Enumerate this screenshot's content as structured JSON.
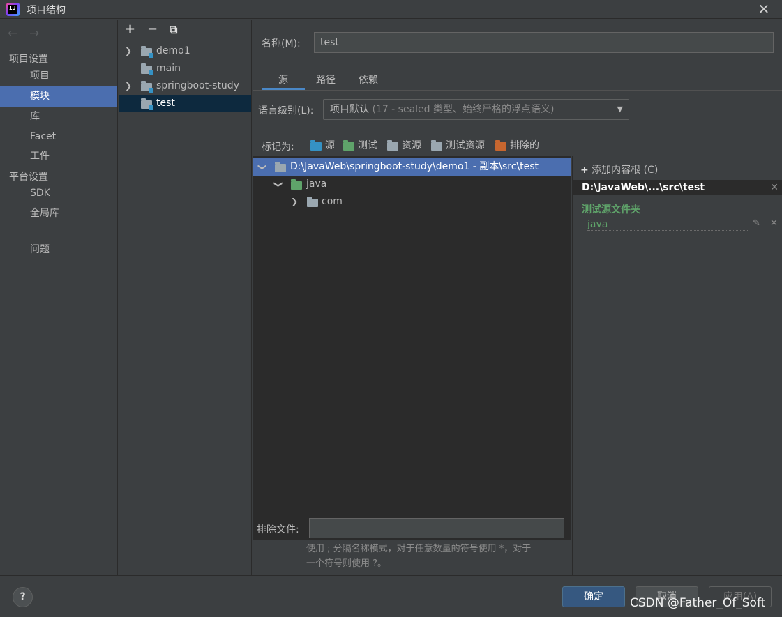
{
  "window": {
    "title": "项目结构",
    "app_icon_text": "IJ"
  },
  "nav": {
    "section_project": "项目设置",
    "section_platform": "平台设置",
    "items": [
      "项目",
      "模块",
      "库",
      "Facet",
      "工件",
      "SDK",
      "全局库",
      "问题"
    ],
    "selected": "模块"
  },
  "modules": {
    "toolbar": {
      "add": "+",
      "remove": "−",
      "copy": "⧉"
    },
    "items": [
      "demo1",
      "main",
      "springboot-study",
      "test"
    ],
    "selected": "test"
  },
  "form": {
    "name_label": "名称(M):",
    "name_value": "test",
    "tabs": [
      "源",
      "路径",
      "依赖"
    ],
    "active_tab": "源",
    "lang_label": "语言级别(L):",
    "lang_value_main": "项目默认",
    "lang_value_detail": "(17 - sealed 类型、始终严格的浮点语义)",
    "mark_label": "标记为:",
    "mark_buttons": [
      "源",
      "测试",
      "资源",
      "测试资源",
      "排除的"
    ]
  },
  "tree": {
    "root": "D:\\JavaWeb\\springboot-study\\demo1 - 副本\\src\\test",
    "child": "java",
    "grandchild": "com"
  },
  "content_roots": {
    "add_label": "添加内容根 (C)",
    "root_header": "D:\\JavaWeb\\...\\src\\test",
    "test_sources_title": "测试源文件夹",
    "test_source_entry": "java"
  },
  "exclude": {
    "label": "排除文件:",
    "value": "",
    "hint_line1": "使用 ; 分隔名称模式，对于任意数量的符号使用 *，对于",
    "hint_line2": "一个符号则使用 ?。"
  },
  "footer": {
    "help": "?",
    "ok": "确定",
    "cancel": "取消",
    "apply": "应用(A)",
    "watermark": "CSDN @Father_Of_Soft"
  },
  "colors": {
    "accent": "#4b6eaf",
    "primary_button": "#365880",
    "test_green": "#5fa36a",
    "source_blue": "#3592c4"
  }
}
